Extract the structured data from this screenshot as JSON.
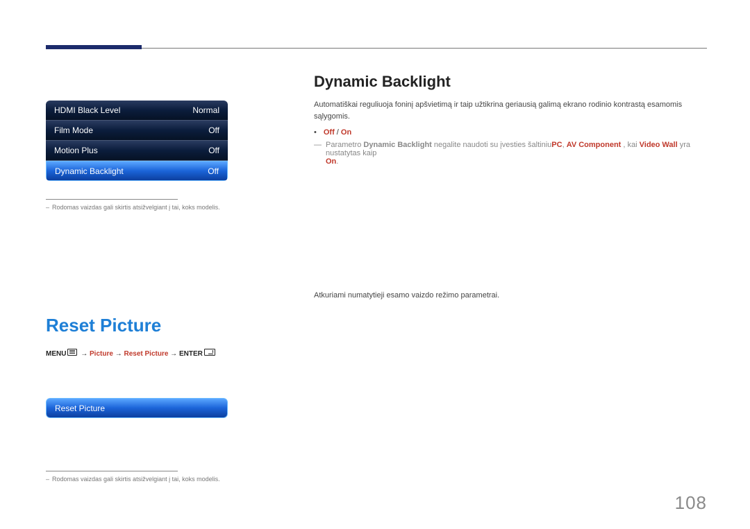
{
  "header": {
    "dynamic_backlight_title": "Dynamic Backlight",
    "reset_picture_title": "Reset Picture"
  },
  "menu1": {
    "items": [
      {
        "label": "HDMI Black Level",
        "value": "Normal"
      },
      {
        "label": "Film Mode",
        "value": "Off"
      },
      {
        "label": "Motion Plus",
        "value": "Off"
      },
      {
        "label": "Dynamic Backlight",
        "value": "Off"
      }
    ]
  },
  "menu2": {
    "items": [
      {
        "label": "Reset Picture"
      }
    ]
  },
  "footnote": "Rodomas vaizdas gali skirtis atsižvelgiant į tai, koks modelis.",
  "dynamic": {
    "desc": "Automatiškai reguliuoja foninį apšvietimą ir taip užtikrina geriausią galimą ekrano rodinio kontrastą esamomis sąlygomis.",
    "opt_off": "Off",
    "opt_sep": " / ",
    "opt_on": "On",
    "note_pre": "Parametro ",
    "note_param": "Dynamic Backlight",
    "note_mid1": " negalite naudoti su įvesties šaltiniu",
    "note_src1": "PC",
    "note_comma1": ", ",
    "note_src2": "AV Component",
    "note_mid2": " , kai ",
    "note_src3": "Video Wall",
    "note_mid3": " yra nustatytas kaip ",
    "note_val": "On",
    "note_end": "."
  },
  "reset": {
    "desc": "Atkuriami numatytieji esamo vaizdo režimo parametrai.",
    "path_menu": "MENU",
    "path_arrow1": " → ",
    "path_red1": "Picture",
    "path_arrow2": " → ",
    "path_red2": "Reset Picture",
    "path_arrow3": " → ",
    "path_enter": "ENTER"
  },
  "page_number": "108"
}
